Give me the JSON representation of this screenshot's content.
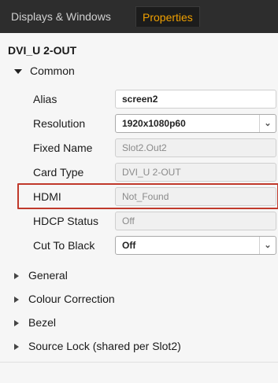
{
  "tabs": {
    "displays_windows": "Displays & Windows",
    "properties": "Properties"
  },
  "device_title": "DVI_U 2-OUT",
  "common": {
    "label": "Common",
    "properties": [
      {
        "label": "Alias",
        "value": "screen2"
      },
      {
        "label": "Resolution",
        "value": "1920x1080p60"
      },
      {
        "label": "Fixed Name",
        "value": "Slot2.Out2"
      },
      {
        "label": "Card Type",
        "value": "DVI_U 2-OUT"
      },
      {
        "label": "HDMI",
        "value": "Not_Found"
      },
      {
        "label": "HDCP Status",
        "value": "Off"
      },
      {
        "label": "Cut To Black",
        "value": "Off"
      }
    ]
  },
  "collapsed_sections": [
    "General",
    "Colour Correction",
    "Bezel",
    "Source Lock (shared per Slot2)"
  ],
  "colors": {
    "active_tab_text": "#f0a000",
    "highlight_border": "#c0392b"
  }
}
